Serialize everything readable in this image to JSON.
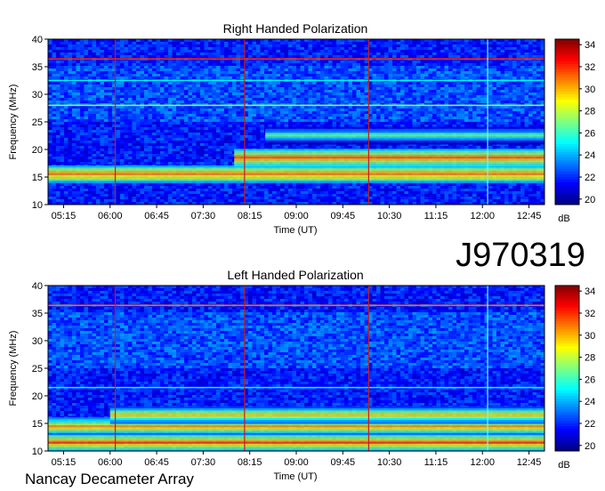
{
  "id_label": "J970319",
  "credit": "Nancay Decameter Array",
  "chart_data": [
    {
      "type": "heatmap",
      "title": "Right Handed Polarization",
      "xlabel": "Time (UT)",
      "ylabel": "Frequency (MHz)",
      "xlim": [
        "05:00",
        "13:00"
      ],
      "ylim": [
        10,
        40
      ],
      "x_ticks": [
        "05:15",
        "06:00",
        "06:45",
        "07:30",
        "08:15",
        "09:00",
        "09:45",
        "10:30",
        "11:15",
        "12:00",
        "12:45"
      ],
      "y_ticks": [
        10,
        15,
        20,
        25,
        30,
        35,
        40
      ],
      "colorbar": {
        "label": "dB",
        "ticks": [
          20,
          22,
          24,
          26,
          28,
          30,
          32,
          34
        ],
        "range": [
          19.5,
          34.5
        ],
        "colormap": "jet"
      },
      "emission_bands": [
        {
          "freq_MHz": 15.5,
          "start": "05:00",
          "end": "13:00",
          "level_dB": 31
        },
        {
          "freq_MHz": 18.5,
          "start": "08:00",
          "end": "13:00",
          "level_dB": 31
        },
        {
          "freq_MHz": 22.5,
          "start": "08:30",
          "end": "13:00",
          "level_dB": 27
        }
      ],
      "interference_lines": [
        {
          "freq_MHz": 36.4,
          "level_dB": 32
        },
        {
          "freq_MHz": 28.0,
          "level_dB": 27
        },
        {
          "freq_MHz": 32.5,
          "level_dB": 25
        }
      ],
      "vertical_lines": [
        {
          "time": "06:05",
          "color": "red"
        },
        {
          "time": "08:10",
          "color": "red"
        },
        {
          "time": "10:10",
          "color": "red"
        },
        {
          "time": "12:05",
          "color": "cyan"
        }
      ]
    },
    {
      "type": "heatmap",
      "title": "Left Handed Polarization",
      "xlabel": "Time (UT)",
      "ylabel": "Frequency (MHz)",
      "xlim": [
        "05:00",
        "13:00"
      ],
      "ylim": [
        10,
        40
      ],
      "x_ticks": [
        "05:15",
        "06:00",
        "06:45",
        "07:30",
        "08:15",
        "09:00",
        "09:45",
        "10:30",
        "11:15",
        "12:00",
        "12:45"
      ],
      "y_ticks": [
        10,
        15,
        20,
        25,
        30,
        35,
        40
      ],
      "colorbar": {
        "label": "dB",
        "ticks": [
          20,
          22,
          24,
          26,
          28,
          30,
          32,
          34
        ],
        "range": [
          19.5,
          34.5
        ],
        "colormap": "jet"
      },
      "emission_bands": [
        {
          "freq_MHz": 11.5,
          "start": "05:00",
          "end": "13:00",
          "level_dB": 31
        },
        {
          "freq_MHz": 14.5,
          "start": "05:00",
          "end": "13:00",
          "level_dB": 30
        },
        {
          "freq_MHz": 16.5,
          "start": "06:00",
          "end": "13:00",
          "level_dB": 29
        }
      ],
      "interference_lines": [
        {
          "freq_MHz": 36.4,
          "level_dB": 31
        },
        {
          "freq_MHz": 21.5,
          "level_dB": 25
        }
      ],
      "vertical_lines": [
        {
          "time": "06:05",
          "color": "red"
        },
        {
          "time": "08:10",
          "color": "red"
        },
        {
          "time": "10:10",
          "color": "red"
        },
        {
          "time": "12:05",
          "color": "cyan"
        }
      ]
    }
  ]
}
